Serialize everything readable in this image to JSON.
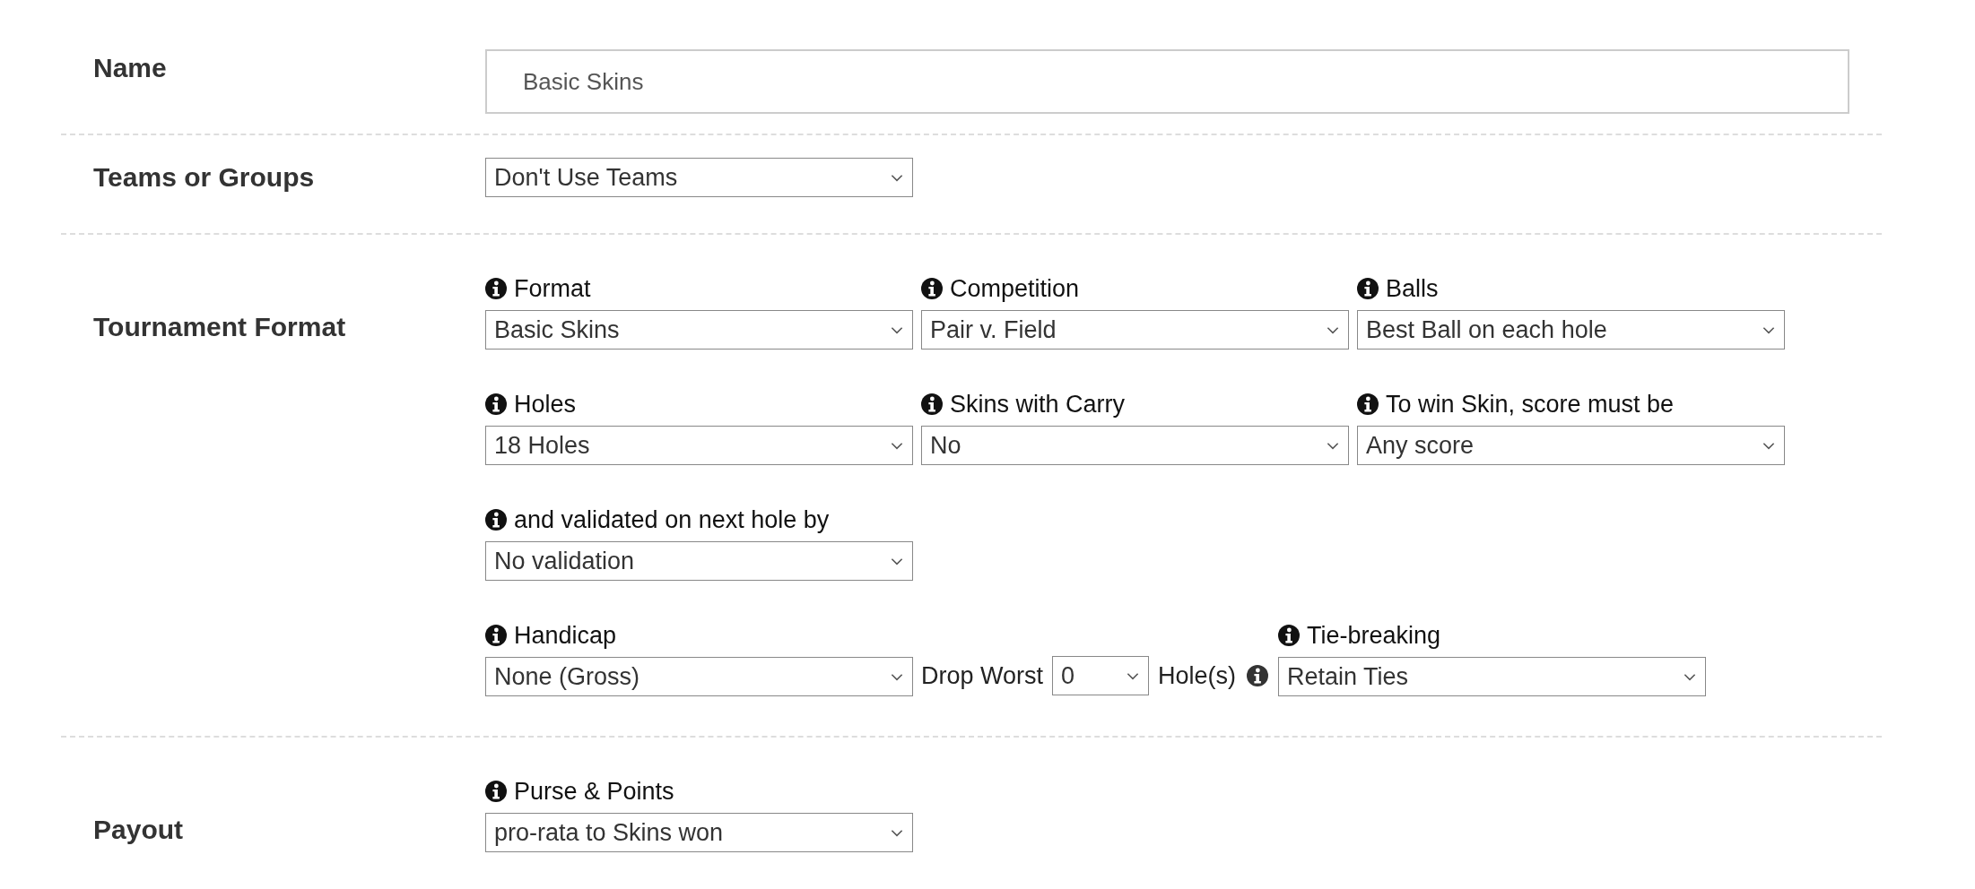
{
  "sections": [
    {
      "label": "Name",
      "kind": "input",
      "value": "Basic Skins"
    },
    {
      "label": "Teams or Groups",
      "kind": "select",
      "value": "Don't Use Teams"
    },
    {
      "label": "Tournament Format",
      "kind": "grid",
      "rows": [
        [
          {
            "kind": "field",
            "label": "Format",
            "value": "Basic Skins"
          },
          {
            "kind": "field",
            "label": "Competition",
            "value": "Pair v. Field"
          },
          {
            "kind": "field",
            "label": "Balls",
            "value": "Best Ball on each hole"
          }
        ],
        [
          {
            "kind": "field",
            "label": "Holes",
            "value": "18 Holes"
          },
          {
            "kind": "field",
            "label": "Skins with Carry",
            "value": "No"
          },
          {
            "kind": "field",
            "label": "To win Skin, score must be",
            "value": "Any score"
          }
        ],
        [
          {
            "kind": "field",
            "label": "and validated on next hole by",
            "value": "No validation"
          }
        ],
        [
          {
            "kind": "field",
            "label": "Handicap",
            "value": "None (Gross)"
          },
          {
            "kind": "drop",
            "label": "Drop Worst",
            "value": "0",
            "suffix": "Hole(s)"
          },
          {
            "kind": "field",
            "label": "Tie-breaking",
            "value": "Retain Ties"
          }
        ]
      ]
    },
    {
      "label": "Payout",
      "kind": "grid",
      "rows": [
        [
          {
            "kind": "field",
            "label": "Purse & Points",
            "value": "pro-rata to Skins won"
          }
        ]
      ]
    }
  ]
}
